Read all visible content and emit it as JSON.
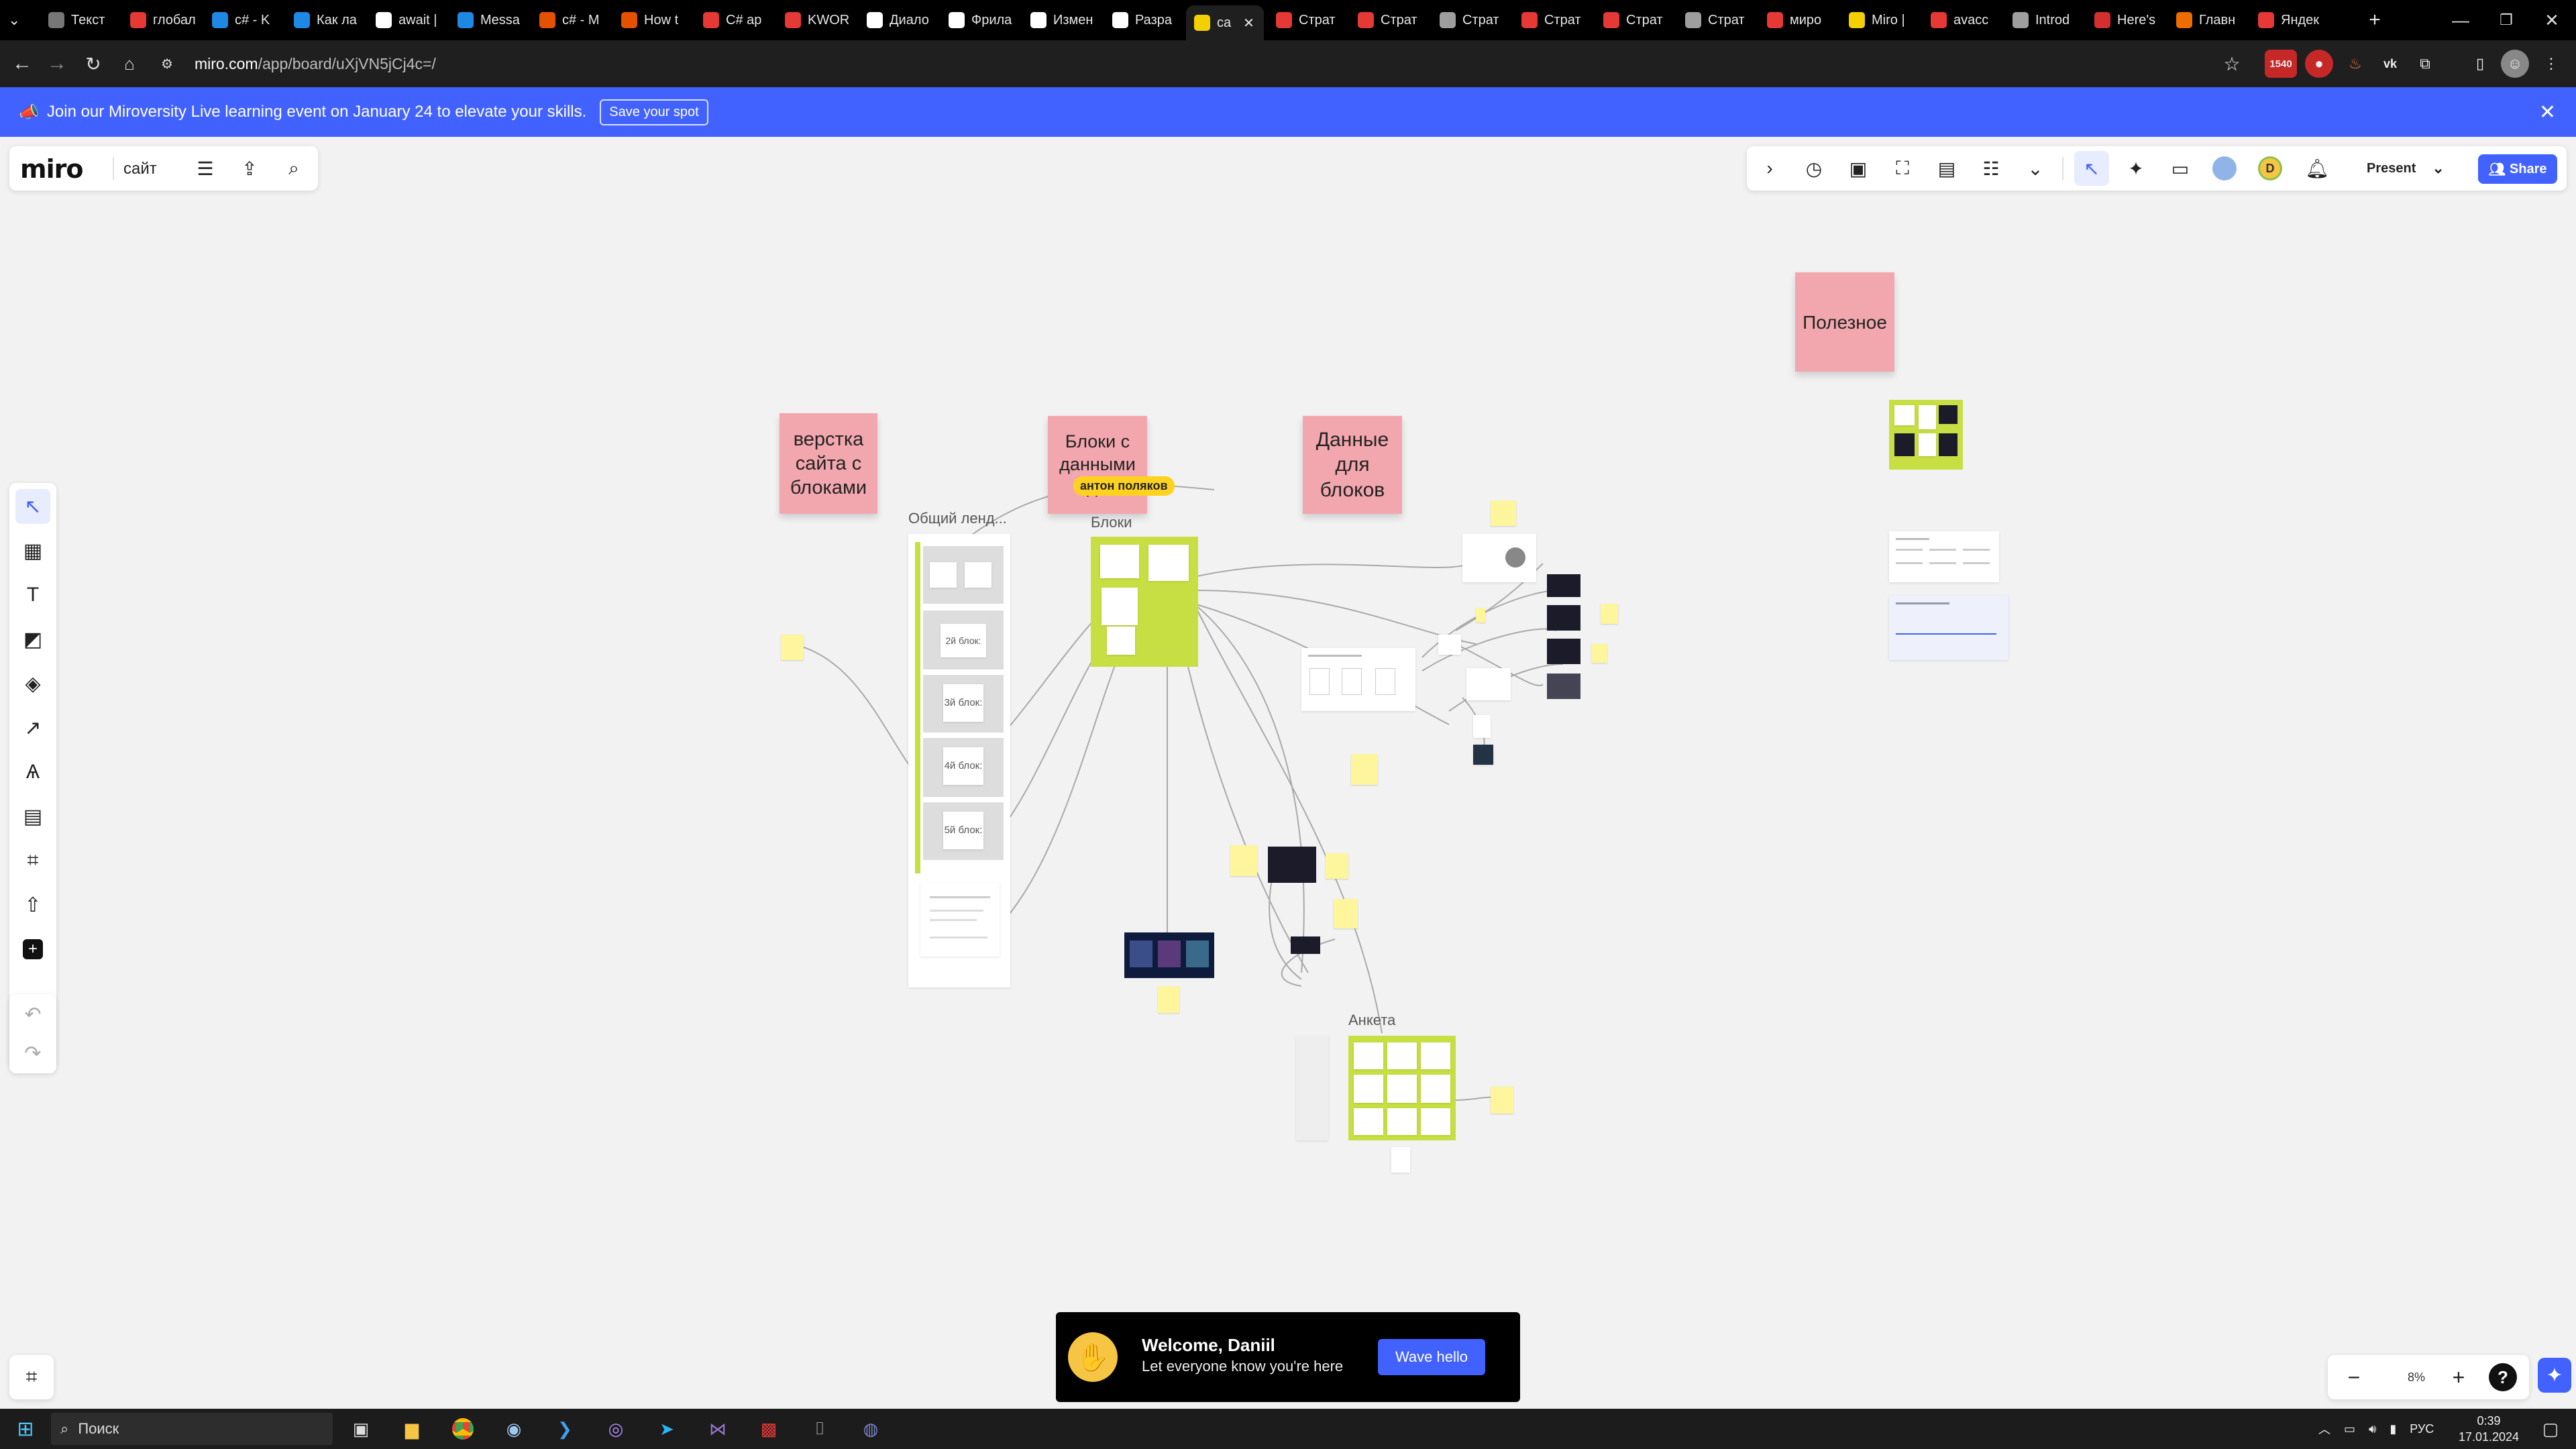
{
  "browser": {
    "tabs": [
      {
        "label": "Текст",
        "color": "#777"
      },
      {
        "label": "глобал",
        "color": "#e53935"
      },
      {
        "label": "c# - K",
        "color": "#1e88e5"
      },
      {
        "label": "Как ла",
        "color": "#1e88e5"
      },
      {
        "label": "await |",
        "color": "#ffffff"
      },
      {
        "label": "Messa",
        "color": "#1e88e5"
      },
      {
        "label": "c# - M",
        "color": "#e65100"
      },
      {
        "label": "How t",
        "color": "#e65100"
      },
      {
        "label": "C# ap",
        "color": "#e53935"
      },
      {
        "label": "KWOR",
        "color": "#e53935"
      },
      {
        "label": "Диало",
        "color": "#ffffff"
      },
      {
        "label": "Фрила",
        "color": "#ffffff"
      },
      {
        "label": "Измен",
        "color": "#ffffff"
      },
      {
        "label": "Разра",
        "color": "#ffffff"
      },
      {
        "label": "са",
        "color": "#f5d000"
      },
      {
        "label": "Страт",
        "color": "#e53935"
      },
      {
        "label": "Страт",
        "color": "#e53935"
      },
      {
        "label": "Страт",
        "color": "#9e9e9e"
      },
      {
        "label": "Страт",
        "color": "#e53935"
      },
      {
        "label": "Страт",
        "color": "#e53935"
      },
      {
        "label": "Страт",
        "color": "#9e9e9e"
      },
      {
        "label": "миро",
        "color": "#e53935"
      },
      {
        "label": "Miro |",
        "color": "#f5d000"
      },
      {
        "label": "avacc",
        "color": "#e53935"
      },
      {
        "label": "Introd",
        "color": "#9e9e9e"
      },
      {
        "label": "Here's",
        "color": "#d32f2f"
      },
      {
        "label": "Главн",
        "color": "#ef6c00"
      },
      {
        "label": "Яндек",
        "color": "#e53935"
      }
    ],
    "url_domain": "miro.com",
    "url_path": "/app/board/uXjVN5jCj4c=/",
    "badge_count": "1540"
  },
  "banner": {
    "text": "Join our Miroversity Live learning event on January 24 to elevate your skills.",
    "button": "Save your spot"
  },
  "toolbar": {
    "logo": "miro",
    "board_name": "сайт",
    "present_label": "Present",
    "share_label": "Share",
    "avatar_letter": "D"
  },
  "canvas": {
    "stickies": {
      "s1": "верстка сайта с блоками",
      "s2": "Блоки с данными дл",
      "s3": "Данные для блоков",
      "s4": "Полезное"
    },
    "frames": {
      "f1": "Общий ленд...",
      "f2": "Блоки",
      "f3": "Анкета"
    },
    "blocks": [
      "2й блок:",
      "3й блок:",
      "4й блок:",
      "5й блок:"
    ],
    "cursor_user": "антон поляков"
  },
  "zoom": {
    "value": "8%"
  },
  "toast": {
    "title": "Welcome, Daniil",
    "subtitle": "Let everyone know you're here",
    "button": "Wave hello"
  },
  "taskbar": {
    "search_placeholder": "Поиск",
    "lang": "РУС",
    "time": "0:39",
    "date": "17.01.2024"
  },
  "colors": {
    "accent": "#4262ff",
    "sticky_pink": "#f2a7ae",
    "frame_green": "#c7df43",
    "canvas_bg": "#f2f2f2"
  }
}
